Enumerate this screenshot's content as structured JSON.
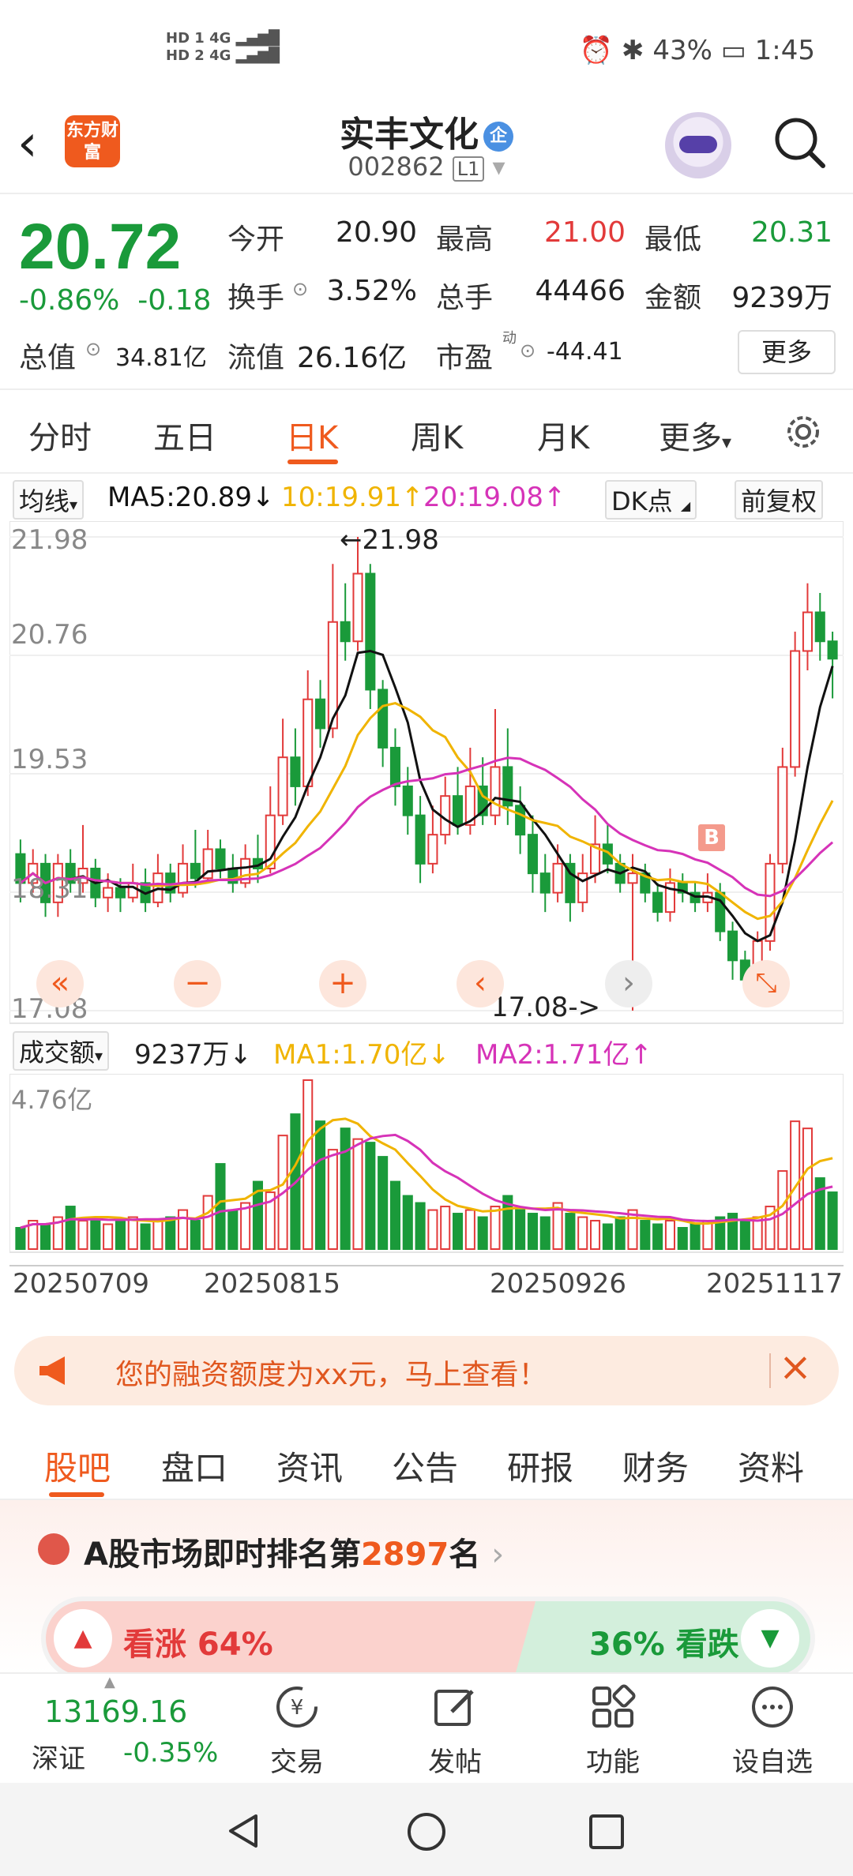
{
  "status": {
    "net1": "HD 1",
    "net2": "HD 2",
    "sig1": "4G",
    "sig2": "4G",
    "battery": "43%",
    "time": "1:45"
  },
  "header": {
    "logo": "东方财富",
    "title": "实丰文化",
    "badge": "企",
    "code": "002862",
    "level": "L1"
  },
  "quote": {
    "price": "20.72",
    "change_pct": "-0.86%",
    "change": "-0.18",
    "open_label": "今开",
    "open": "20.90",
    "high_label": "最高",
    "high": "21.00",
    "low_label": "最低",
    "low": "20.31",
    "turnover_label": "换手",
    "turnover": "3.52%",
    "vol_label": "总手",
    "vol": "44466",
    "amount_label": "金额",
    "amount": "9239万",
    "mcap_label": "总值",
    "mcap": "34.81亿",
    "float_label": "流值",
    "float": "26.16亿",
    "pe_label": "市盈",
    "pe_sup": "动",
    "pe": "-44.41",
    "more": "更多"
  },
  "tabs": [
    "分时",
    "五日",
    "日K",
    "周K",
    "月K",
    "更多"
  ],
  "ma": {
    "selector": "均线",
    "ma5": "MA5:20.89↓",
    "ma10": "10:19.91↑",
    "ma20": "20:19.08↑",
    "dk": "DK点",
    "fq": "前复权"
  },
  "kchart": {
    "y_ticks": [
      "21.98",
      "20.76",
      "19.53",
      "18.31",
      "17.08"
    ],
    "max_label": "←21.98",
    "min_label": "17.08->",
    "marker": "B"
  },
  "vol": {
    "selector": "成交额",
    "value": "9237万↓",
    "ma1": "MA1:1.70亿↓",
    "ma2": "MA2:1.71亿↑",
    "y_top": "4.76亿"
  },
  "dates": [
    "20250709",
    "20250815",
    "20250926",
    "20251117"
  ],
  "banner": {
    "text": "您的融资额度为xx元，马上查看！"
  },
  "bottom_tabs": [
    "股吧",
    "盘口",
    "资讯",
    "公告",
    "研报",
    "财务",
    "资料"
  ],
  "rank": {
    "prefix": "A股市场即时排名第",
    "num": "2897",
    "suffix": "名",
    "up": "看涨 64%",
    "down": "36% 看跌"
  },
  "index": {
    "value": "13169.16",
    "name": "深证",
    "change": "-0.35%"
  },
  "bottom_nav": [
    "交易",
    "发帖",
    "功能",
    "设自选"
  ],
  "colors": {
    "up": "#e23a3a",
    "down": "#1a9a3a",
    "accent": "#ef5a1e",
    "ma5": "#111111",
    "ma10": "#f0b400",
    "ma20": "#d633b8"
  },
  "chart_data": {
    "type": "candlestick",
    "ylim": [
      17.08,
      21.98
    ],
    "candles": [
      [
        18.7,
        18.4,
        18.85,
        18.2
      ],
      [
        18.4,
        18.6,
        18.75,
        18.3
      ],
      [
        18.6,
        18.2,
        18.7,
        18.05
      ],
      [
        18.2,
        18.6,
        18.7,
        18.05
      ],
      [
        18.6,
        18.4,
        18.75,
        18.3
      ],
      [
        18.4,
        18.55,
        19.0,
        18.3
      ],
      [
        18.55,
        18.25,
        18.65,
        18.15
      ],
      [
        18.25,
        18.35,
        18.5,
        18.1
      ],
      [
        18.35,
        18.25,
        18.45,
        18.1
      ],
      [
        18.25,
        18.4,
        18.6,
        18.2
      ],
      [
        18.4,
        18.2,
        18.55,
        18.1
      ],
      [
        18.2,
        18.5,
        18.7,
        18.15
      ],
      [
        18.5,
        18.3,
        18.6,
        18.2
      ],
      [
        18.3,
        18.6,
        18.8,
        18.25
      ],
      [
        18.6,
        18.45,
        18.95,
        18.35
      ],
      [
        18.45,
        18.75,
        18.95,
        18.4
      ],
      [
        18.75,
        18.55,
        18.85,
        18.45
      ],
      [
        18.55,
        18.4,
        18.7,
        18.3
      ],
      [
        18.4,
        18.65,
        18.8,
        18.35
      ],
      [
        18.65,
        18.55,
        18.9,
        18.4
      ],
      [
        18.55,
        19.1,
        19.4,
        18.5
      ],
      [
        19.1,
        19.7,
        20.1,
        19.0
      ],
      [
        19.7,
        19.4,
        20.0,
        19.2
      ],
      [
        19.4,
        20.3,
        20.6,
        19.3
      ],
      [
        20.3,
        20.0,
        20.5,
        19.8
      ],
      [
        20.0,
        21.1,
        21.7,
        19.9
      ],
      [
        21.1,
        20.9,
        21.5,
        20.7
      ],
      [
        20.9,
        21.6,
        21.98,
        20.8
      ],
      [
        21.6,
        20.4,
        21.7,
        20.2
      ],
      [
        20.4,
        19.8,
        20.5,
        19.6
      ],
      [
        19.8,
        19.4,
        20.0,
        19.2
      ],
      [
        19.4,
        19.1,
        19.6,
        18.9
      ],
      [
        19.1,
        18.6,
        19.3,
        18.4
      ],
      [
        18.6,
        18.9,
        19.2,
        18.5
      ],
      [
        18.9,
        19.3,
        19.5,
        18.8
      ],
      [
        19.3,
        19.0,
        19.6,
        18.9
      ],
      [
        19.0,
        19.4,
        19.8,
        18.9
      ],
      [
        19.4,
        19.1,
        19.7,
        19.0
      ],
      [
        19.1,
        19.6,
        20.2,
        19.0
      ],
      [
        19.6,
        19.2,
        20.0,
        19.0
      ],
      [
        19.2,
        18.9,
        19.4,
        18.7
      ],
      [
        18.9,
        18.5,
        19.1,
        18.3
      ],
      [
        18.5,
        18.3,
        18.7,
        18.1
      ],
      [
        18.3,
        18.6,
        18.8,
        18.2
      ],
      [
        18.6,
        18.2,
        18.7,
        18.0
      ],
      [
        18.2,
        18.5,
        18.7,
        18.1
      ],
      [
        18.5,
        18.8,
        19.1,
        18.4
      ],
      [
        18.8,
        18.6,
        19.0,
        18.5
      ],
      [
        18.6,
        18.4,
        18.7,
        18.3
      ],
      [
        18.4,
        18.5,
        18.7,
        17.08
      ],
      [
        18.5,
        18.3,
        18.6,
        18.2
      ],
      [
        18.3,
        18.1,
        18.4,
        18.0
      ],
      [
        18.1,
        18.4,
        18.55,
        18.0
      ],
      [
        18.4,
        18.3,
        18.5,
        18.2
      ],
      [
        18.3,
        18.2,
        18.4,
        18.1
      ],
      [
        18.2,
        18.3,
        18.5,
        18.1
      ],
      [
        18.3,
        17.9,
        18.4,
        17.8
      ],
      [
        17.9,
        17.6,
        18.0,
        17.4
      ],
      [
        17.6,
        17.4,
        17.7,
        17.3
      ],
      [
        17.4,
        17.8,
        17.9,
        17.35
      ],
      [
        17.8,
        18.6,
        18.7,
        17.7
      ],
      [
        18.6,
        19.6,
        19.8,
        18.5
      ],
      [
        19.6,
        20.8,
        21.0,
        19.5
      ],
      [
        20.8,
        21.2,
        21.5,
        20.6
      ],
      [
        21.2,
        20.9,
        21.4,
        20.7
      ],
      [
        20.9,
        20.72,
        21.0,
        20.31
      ]
    ],
    "volume_yi": [
      0.6,
      0.8,
      0.7,
      0.9,
      1.2,
      0.8,
      0.9,
      0.7,
      0.8,
      0.9,
      0.7,
      0.8,
      0.9,
      1.1,
      0.8,
      1.5,
      2.4,
      1.1,
      1.3,
      1.9,
      1.6,
      3.2,
      3.8,
      4.76,
      3.6,
      2.8,
      3.4,
      3.1,
      3.0,
      2.6,
      1.9,
      1.5,
      1.3,
      1.1,
      1.2,
      1.0,
      1.1,
      0.9,
      1.2,
      1.5,
      1.1,
      1.0,
      0.9,
      1.3,
      1.0,
      0.9,
      0.8,
      0.7,
      0.9,
      1.1,
      0.8,
      0.7,
      0.8,
      0.6,
      0.7,
      0.8,
      0.9,
      1.0,
      0.8,
      0.9,
      1.2,
      2.2,
      3.6,
      3.4,
      2.0,
      1.6
    ],
    "x_ticks": [
      "20250709",
      "20250815",
      "20250926",
      "20251117"
    ]
  }
}
